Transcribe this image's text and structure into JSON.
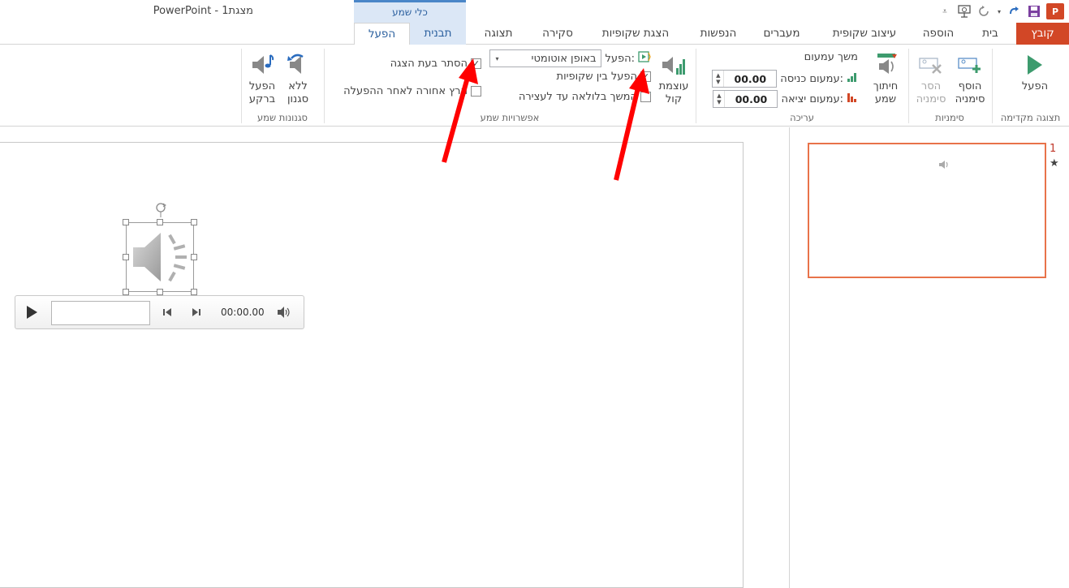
{
  "window": {
    "title": "PowerPoint - מצגת1",
    "app_logo_text": "P"
  },
  "contextual": {
    "group_title": "כלי שמע"
  },
  "tabs": {
    "file": "קובץ",
    "home": "בית",
    "insert": "הוספה",
    "design": "עיצוב שקופית",
    "transitions": "מעברים",
    "animations": "הנפשות",
    "slideshow": "הצגת שקופיות",
    "review": "סקירה",
    "view": "תצוגה",
    "format": "תבנית",
    "playback": "הפעל"
  },
  "ribbon": {
    "preview": {
      "play_label": "הפעל",
      "group_label": "תצוגה מקדימה"
    },
    "bookmarks": {
      "add_label": "הוסף סימניה",
      "remove_label": "הסר סימניה",
      "group_label": "סימניות"
    },
    "editing": {
      "trim_label": "חיתוך שמע",
      "fade_duration_label": "משך עמעום",
      "fade_in_label": "עמעום כניסה:",
      "fade_out_label": "עמעום יציאה:",
      "fade_in_value": "00.00",
      "fade_out_value": "00.00",
      "group_label": "עריכה"
    },
    "audio_options": {
      "volume_label": "עוצמת קול",
      "start_label": "הפעל:",
      "start_value": "באופן אוטומטי",
      "play_across_slides_label": "הפעל בין שקופיות",
      "play_across_slides_checked": true,
      "loop_label": "המשך בלולאה עד לעצירה",
      "loop_checked": false,
      "hide_during_show_label": "הסתר בעת הצגה",
      "hide_during_show_checked": true,
      "rewind_label": "הרץ אחורה לאחר ההפעלה",
      "rewind_checked": false,
      "group_label": "אפשרויות שמע"
    },
    "audio_styles": {
      "no_style_label": "ללא סגנון",
      "play_bg_label": "הפעל ברקע",
      "group_label": "סגנונות שמע"
    }
  },
  "player": {
    "time": "00:00.00"
  },
  "thumbnails": {
    "slide_number": "1",
    "animation_marker": "★"
  },
  "colors": {
    "file_tab": "#d24726",
    "contextual": "#dbe7f6",
    "accent_blue": "#2a5f9e",
    "annotation_arrow": "#ff0000",
    "thumb_border": "#e8734a"
  }
}
